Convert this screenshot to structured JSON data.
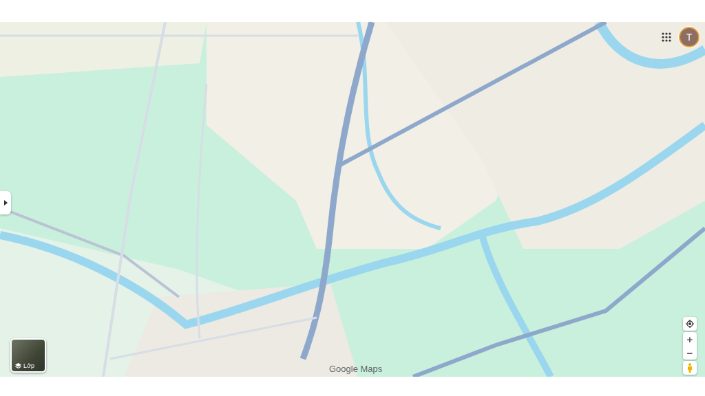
{
  "account": {
    "initial": "T"
  },
  "zoom_controls": {
    "zoom_in": "+",
    "zoom_out": "−"
  },
  "layers_button": {
    "label": "Lớp"
  },
  "map": {
    "attribution": "Google Maps"
  }
}
